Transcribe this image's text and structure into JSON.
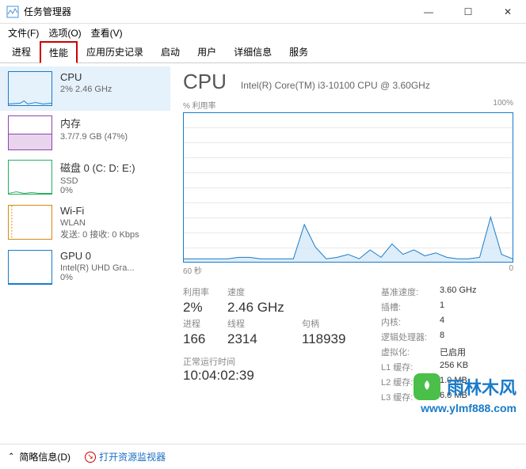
{
  "window": {
    "title": "任务管理器",
    "min": "—",
    "max": "☐",
    "close": "✕"
  },
  "menu": {
    "file": "文件(F)",
    "options": "选项(O)",
    "view": "查看(V)"
  },
  "tabs": {
    "processes": "进程",
    "performance": "性能",
    "app_history": "应用历史记录",
    "startup": "启动",
    "users": "用户",
    "details": "详细信息",
    "services": "服务"
  },
  "sidebar": {
    "cpu": {
      "title": "CPU",
      "sub": "2% 2.46 GHz"
    },
    "memory": {
      "title": "内存",
      "sub": "3.7/7.9 GB (47%)"
    },
    "disk": {
      "title": "磁盘 0 (C: D: E:)",
      "sub1": "SSD",
      "sub2": "0%"
    },
    "wifi": {
      "title": "Wi-Fi",
      "sub1": "WLAN",
      "sub2": "发送: 0 接收: 0 Kbps"
    },
    "gpu": {
      "title": "GPU 0",
      "sub1": "Intel(R) UHD Gra...",
      "sub2": "0%"
    }
  },
  "main": {
    "title": "CPU",
    "name": "Intel(R) Core(TM) i3-10100 CPU @ 3.60GHz",
    "y_label": "% 利用率",
    "y_max": "100%",
    "x_left": "60 秒",
    "x_right": "0"
  },
  "stats": {
    "util_label": "利用率",
    "util_value": "2%",
    "speed_label": "速度",
    "speed_value": "2.46 GHz",
    "proc_label": "进程",
    "proc_value": "166",
    "threads_label": "线程",
    "threads_value": "2314",
    "handles_label": "句柄",
    "handles_value": "118939",
    "uptime_label": "正常运行时间",
    "uptime_value": "10:04:02:39"
  },
  "right_stats": {
    "base_label": "基准速度:",
    "base_value": "3.60 GHz",
    "sockets_label": "插槽:",
    "sockets_value": "1",
    "cores_label": "内核:",
    "cores_value": "4",
    "logical_label": "逻辑处理器:",
    "logical_value": "8",
    "virt_label": "虚拟化:",
    "virt_value": "已启用",
    "l1_label": "L1 缓存:",
    "l1_value": "256 KB",
    "l2_label": "L2 缓存:",
    "l2_value": "1.0 MB",
    "l3_label": "L3 缓存:",
    "l3_value": "6.0 MB"
  },
  "bottom": {
    "brief": "简略信息(D)",
    "resmon": "打开资源监视器"
  },
  "watermark": {
    "text": "雨林木风",
    "url": "www.ylmf888.com"
  },
  "chart_data": {
    "type": "line",
    "title": "% 利用率",
    "xlabel": "60 秒",
    "ylabel": "% 利用率",
    "ylim": [
      0,
      100
    ],
    "x_seconds": [
      60,
      58,
      56,
      54,
      52,
      50,
      48,
      46,
      44,
      42,
      40,
      38,
      36,
      34,
      32,
      30,
      28,
      26,
      24,
      22,
      20,
      18,
      16,
      14,
      12,
      10,
      8,
      6,
      4,
      2,
      0
    ],
    "values": [
      2,
      2,
      2,
      2,
      2,
      3,
      3,
      2,
      2,
      2,
      2,
      25,
      10,
      2,
      3,
      5,
      2,
      8,
      3,
      12,
      5,
      8,
      4,
      6,
      3,
      2,
      2,
      3,
      30,
      5,
      2
    ]
  }
}
